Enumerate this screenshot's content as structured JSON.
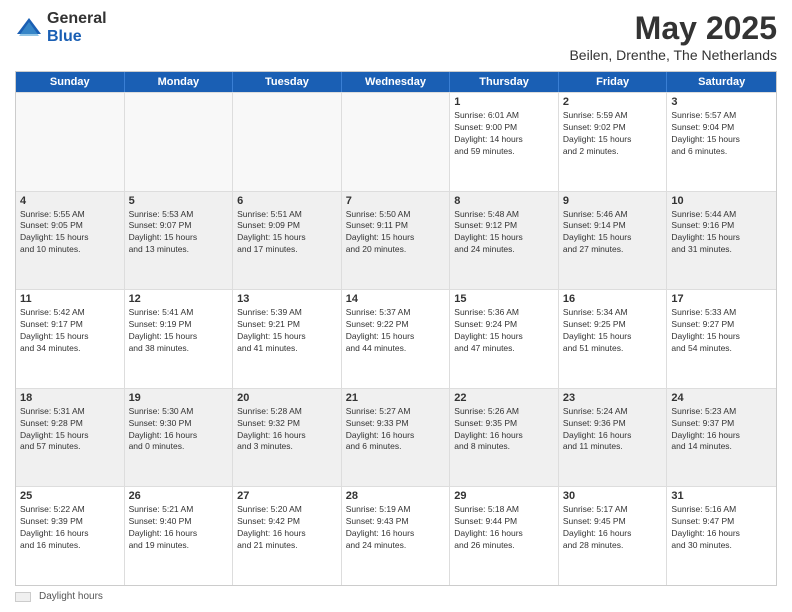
{
  "logo": {
    "general": "General",
    "blue": "Blue"
  },
  "header": {
    "month": "May 2025",
    "location": "Beilen, Drenthe, The Netherlands"
  },
  "weekdays": [
    "Sunday",
    "Monday",
    "Tuesday",
    "Wednesday",
    "Thursday",
    "Friday",
    "Saturday"
  ],
  "footer": {
    "label": "Daylight hours"
  },
  "weeks": [
    [
      {
        "day": "",
        "info": "",
        "empty": true
      },
      {
        "day": "",
        "info": "",
        "empty": true
      },
      {
        "day": "",
        "info": "",
        "empty": true
      },
      {
        "day": "",
        "info": "",
        "empty": true
      },
      {
        "day": "1",
        "info": "Sunrise: 6:01 AM\nSunset: 9:00 PM\nDaylight: 14 hours\nand 59 minutes."
      },
      {
        "day": "2",
        "info": "Sunrise: 5:59 AM\nSunset: 9:02 PM\nDaylight: 15 hours\nand 2 minutes."
      },
      {
        "day": "3",
        "info": "Sunrise: 5:57 AM\nSunset: 9:04 PM\nDaylight: 15 hours\nand 6 minutes."
      }
    ],
    [
      {
        "day": "4",
        "info": "Sunrise: 5:55 AM\nSunset: 9:05 PM\nDaylight: 15 hours\nand 10 minutes."
      },
      {
        "day": "5",
        "info": "Sunrise: 5:53 AM\nSunset: 9:07 PM\nDaylight: 15 hours\nand 13 minutes."
      },
      {
        "day": "6",
        "info": "Sunrise: 5:51 AM\nSunset: 9:09 PM\nDaylight: 15 hours\nand 17 minutes."
      },
      {
        "day": "7",
        "info": "Sunrise: 5:50 AM\nSunset: 9:11 PM\nDaylight: 15 hours\nand 20 minutes."
      },
      {
        "day": "8",
        "info": "Sunrise: 5:48 AM\nSunset: 9:12 PM\nDaylight: 15 hours\nand 24 minutes."
      },
      {
        "day": "9",
        "info": "Sunrise: 5:46 AM\nSunset: 9:14 PM\nDaylight: 15 hours\nand 27 minutes."
      },
      {
        "day": "10",
        "info": "Sunrise: 5:44 AM\nSunset: 9:16 PM\nDaylight: 15 hours\nand 31 minutes."
      }
    ],
    [
      {
        "day": "11",
        "info": "Sunrise: 5:42 AM\nSunset: 9:17 PM\nDaylight: 15 hours\nand 34 minutes."
      },
      {
        "day": "12",
        "info": "Sunrise: 5:41 AM\nSunset: 9:19 PM\nDaylight: 15 hours\nand 38 minutes."
      },
      {
        "day": "13",
        "info": "Sunrise: 5:39 AM\nSunset: 9:21 PM\nDaylight: 15 hours\nand 41 minutes."
      },
      {
        "day": "14",
        "info": "Sunrise: 5:37 AM\nSunset: 9:22 PM\nDaylight: 15 hours\nand 44 minutes."
      },
      {
        "day": "15",
        "info": "Sunrise: 5:36 AM\nSunset: 9:24 PM\nDaylight: 15 hours\nand 47 minutes."
      },
      {
        "day": "16",
        "info": "Sunrise: 5:34 AM\nSunset: 9:25 PM\nDaylight: 15 hours\nand 51 minutes."
      },
      {
        "day": "17",
        "info": "Sunrise: 5:33 AM\nSunset: 9:27 PM\nDaylight: 15 hours\nand 54 minutes."
      }
    ],
    [
      {
        "day": "18",
        "info": "Sunrise: 5:31 AM\nSunset: 9:28 PM\nDaylight: 15 hours\nand 57 minutes."
      },
      {
        "day": "19",
        "info": "Sunrise: 5:30 AM\nSunset: 9:30 PM\nDaylight: 16 hours\nand 0 minutes."
      },
      {
        "day": "20",
        "info": "Sunrise: 5:28 AM\nSunset: 9:32 PM\nDaylight: 16 hours\nand 3 minutes."
      },
      {
        "day": "21",
        "info": "Sunrise: 5:27 AM\nSunset: 9:33 PM\nDaylight: 16 hours\nand 6 minutes."
      },
      {
        "day": "22",
        "info": "Sunrise: 5:26 AM\nSunset: 9:35 PM\nDaylight: 16 hours\nand 8 minutes."
      },
      {
        "day": "23",
        "info": "Sunrise: 5:24 AM\nSunset: 9:36 PM\nDaylight: 16 hours\nand 11 minutes."
      },
      {
        "day": "24",
        "info": "Sunrise: 5:23 AM\nSunset: 9:37 PM\nDaylight: 16 hours\nand 14 minutes."
      }
    ],
    [
      {
        "day": "25",
        "info": "Sunrise: 5:22 AM\nSunset: 9:39 PM\nDaylight: 16 hours\nand 16 minutes."
      },
      {
        "day": "26",
        "info": "Sunrise: 5:21 AM\nSunset: 9:40 PM\nDaylight: 16 hours\nand 19 minutes."
      },
      {
        "day": "27",
        "info": "Sunrise: 5:20 AM\nSunset: 9:42 PM\nDaylight: 16 hours\nand 21 minutes."
      },
      {
        "day": "28",
        "info": "Sunrise: 5:19 AM\nSunset: 9:43 PM\nDaylight: 16 hours\nand 24 minutes."
      },
      {
        "day": "29",
        "info": "Sunrise: 5:18 AM\nSunset: 9:44 PM\nDaylight: 16 hours\nand 26 minutes."
      },
      {
        "day": "30",
        "info": "Sunrise: 5:17 AM\nSunset: 9:45 PM\nDaylight: 16 hours\nand 28 minutes."
      },
      {
        "day": "31",
        "info": "Sunrise: 5:16 AM\nSunset: 9:47 PM\nDaylight: 16 hours\nand 30 minutes."
      }
    ]
  ]
}
